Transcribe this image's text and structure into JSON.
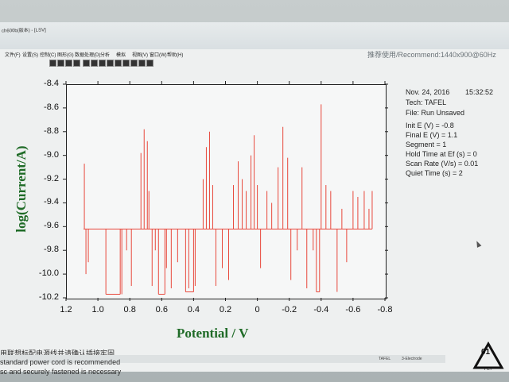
{
  "window": {
    "title": "ch600b(版本) - [LSV]",
    "resolution_hint": "推荐使用/Recommend:1440x900@60Hz"
  },
  "menu": [
    "文件(F)",
    "设置(S)",
    "控制(C)",
    "图形(G)",
    "数据处理(D)",
    "分析",
    "模拟",
    "视图(V)",
    "窗口(W)",
    "帮助(H)"
  ],
  "info": {
    "date": "Nov. 24, 2016",
    "time": "15:32:52",
    "tech": "Tech: TAFEL",
    "file": "File: Run Unsaved",
    "params": [
      "Init E (V) = -0.8",
      "Final E (V) = 1.1",
      "Segment = 1",
      "Hold Time at Ef (s) = 0",
      "Scan Rate (V/s) = 0.01",
      "Quiet Time (s) = 2"
    ]
  },
  "footer": {
    "line1": "用联想标配电源线并请确认插接牢固",
    "line2": "standard power cord is recommended",
    "line3": "sc and securely fastened is necessary"
  },
  "status": {
    "tech": "TAFEL",
    "electrode": "3-Electrode"
  },
  "logo": {
    "number": "01",
    "label": "PET"
  },
  "colors": {
    "trace": "#e8483c",
    "axis_title": "#1f6b27"
  },
  "chart_data": {
    "type": "line",
    "xlabel": "Potential / V",
    "ylabel": "log(Current/A)",
    "xlim": [
      1.2,
      -0.8
    ],
    "ylim": [
      -10.2,
      -8.4
    ],
    "x_ticks": [
      "1.2",
      "1.0",
      "0.8",
      "0.6",
      "0.4",
      "0.2",
      "0",
      "-0.2",
      "-0.4",
      "-0.6",
      "-0.8"
    ],
    "y_ticks": [
      "-8.4",
      "-8.6",
      "-8.8",
      "-9.0",
      "-9.2",
      "-9.4",
      "-9.6",
      "-9.8",
      "-10.0",
      "-10.2"
    ],
    "grid": false,
    "series": [
      {
        "baseline": -9.62,
        "spikes": [
          {
            "x": 1.085,
            "y": -9.07
          },
          {
            "x": 1.075,
            "y": -10.0
          },
          {
            "x": 1.06,
            "y": -9.9
          },
          {
            "x": 0.85,
            "y": -10.17
          },
          {
            "x": 0.82,
            "y": -9.8
          },
          {
            "x": 0.79,
            "y": -10.1
          },
          {
            "x": 0.73,
            "y": -8.98
          },
          {
            "x": 0.71,
            "y": -8.78
          },
          {
            "x": 0.69,
            "y": -8.88
          },
          {
            "x": 0.68,
            "y": -9.3
          },
          {
            "x": 0.66,
            "y": -10.1
          },
          {
            "x": 0.64,
            "y": -9.8
          },
          {
            "x": 0.57,
            "y": -9.95
          },
          {
            "x": 0.54,
            "y": -10.12
          },
          {
            "x": 0.5,
            "y": -9.9
          },
          {
            "x": 0.43,
            "y": -10.12
          },
          {
            "x": 0.39,
            "y": -10.1
          },
          {
            "x": 0.34,
            "y": -9.2
          },
          {
            "x": 0.32,
            "y": -8.93
          },
          {
            "x": 0.3,
            "y": -8.8
          },
          {
            "x": 0.28,
            "y": -9.25
          },
          {
            "x": 0.26,
            "y": -10.1
          },
          {
            "x": 0.22,
            "y": -9.95
          },
          {
            "x": 0.18,
            "y": -10.05
          },
          {
            "x": 0.15,
            "y": -9.25
          },
          {
            "x": 0.12,
            "y": -9.05
          },
          {
            "x": 0.095,
            "y": -9.2
          },
          {
            "x": 0.07,
            "y": -9.3
          },
          {
            "x": 0.04,
            "y": -9.0
          },
          {
            "x": 0.02,
            "y": -8.83
          },
          {
            "x": 0.0,
            "y": -9.25
          },
          {
            "x": -0.02,
            "y": -9.95
          },
          {
            "x": -0.06,
            "y": -9.3
          },
          {
            "x": -0.09,
            "y": -9.4
          },
          {
            "x": -0.13,
            "y": -9.1
          },
          {
            "x": -0.16,
            "y": -8.76
          },
          {
            "x": -0.19,
            "y": -9.02
          },
          {
            "x": -0.21,
            "y": -10.05
          },
          {
            "x": -0.25,
            "y": -9.8
          },
          {
            "x": -0.28,
            "y": -9.1
          },
          {
            "x": -0.31,
            "y": -10.12
          },
          {
            "x": -0.35,
            "y": -9.8
          },
          {
            "x": -0.4,
            "y": -8.57
          },
          {
            "x": -0.43,
            "y": -9.25
          },
          {
            "x": -0.46,
            "y": -9.3
          },
          {
            "x": -0.5,
            "y": -10.15
          },
          {
            "x": -0.53,
            "y": -9.45
          },
          {
            "x": -0.56,
            "y": -9.9
          },
          {
            "x": -0.6,
            "y": -9.3
          },
          {
            "x": -0.63,
            "y": -9.35
          },
          {
            "x": -0.67,
            "y": -9.3
          },
          {
            "x": -0.7,
            "y": -9.45
          },
          {
            "x": -0.72,
            "y": -9.3
          }
        ],
        "steps": [
          {
            "x1": 0.95,
            "x2": 0.86,
            "y": -10.17
          },
          {
            "x1": 0.62,
            "x2": 0.58,
            "y": -10.17
          },
          {
            "x1": 0.45,
            "x2": 0.4,
            "y": -10.15
          },
          {
            "x1": -0.37,
            "x2": -0.39,
            "y": -10.15
          }
        ]
      }
    ]
  }
}
